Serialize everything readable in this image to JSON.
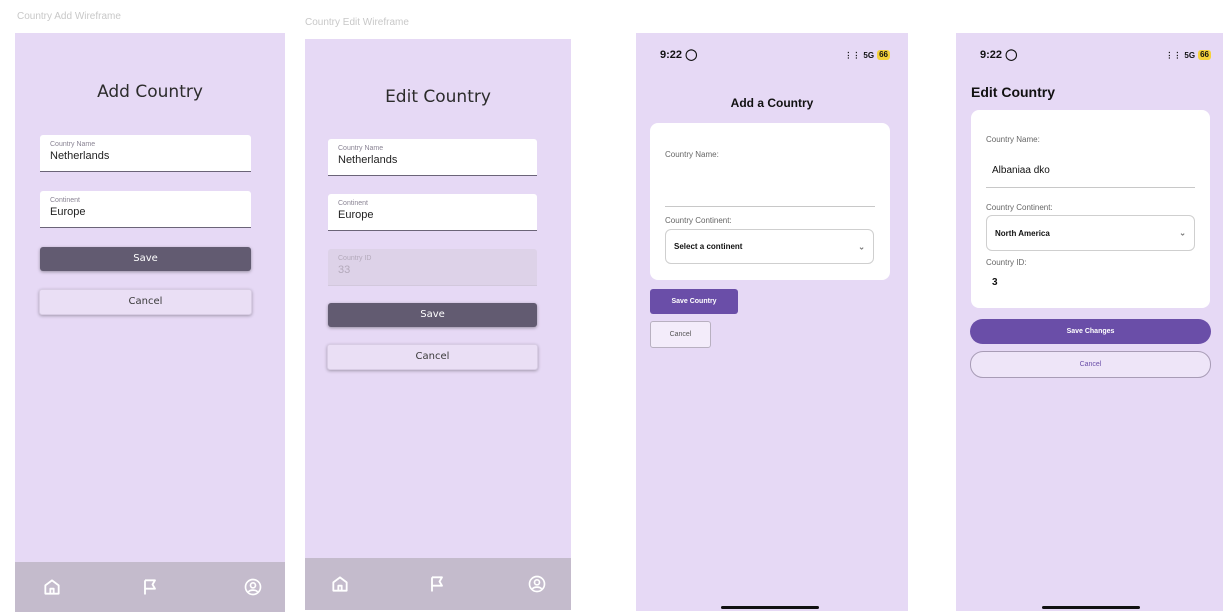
{
  "add_wireframe": {
    "frame_label": "Country Add Wireframe",
    "title": "Add Country",
    "country_name_label": "Country Name",
    "country_name_value": "Netherlands",
    "continent_label": "Continent",
    "continent_value": "Europe",
    "save_label": "Save",
    "cancel_label": "Cancel"
  },
  "edit_wireframe": {
    "frame_label": "Country Edit Wireframe",
    "title": "Edit Country",
    "country_name_label": "Country Name",
    "country_name_value": "Netherlands",
    "continent_label": "Continent",
    "continent_value": "Europe",
    "country_id_label": "Country ID",
    "country_id_value": "33",
    "save_label": "Save",
    "cancel_label": "Cancel"
  },
  "nav": {
    "items": [
      "home-icon",
      "flag-icon",
      "profile-icon"
    ]
  },
  "add_phone": {
    "status_time": "9:22",
    "status_signal": "5G",
    "battery": "66",
    "title": "Add a Country",
    "country_name_label": "Country Name:",
    "continent_label": "Country Continent:",
    "continent_placeholder": "Select a continent",
    "save_label": "Save Country",
    "cancel_label": "Cancel"
  },
  "edit_phone": {
    "status_time": "9:22",
    "status_signal": "5G",
    "battery": "66",
    "title": "Edit Country",
    "country_name_label": "Country Name:",
    "country_name_value": "Albaniaa dko",
    "continent_label": "Country Continent:",
    "continent_value": "North America",
    "country_id_label": "Country ID:",
    "country_id_value": "3",
    "save_label": "Save Changes",
    "cancel_label": "Cancel"
  },
  "colors": {
    "frame_bg": "#e6d9f5",
    "wf_primary": "#625b71",
    "ph_primary": "#6a4ea8",
    "nav_bg": "#c4bbcc",
    "battery": "#f5d23a"
  }
}
